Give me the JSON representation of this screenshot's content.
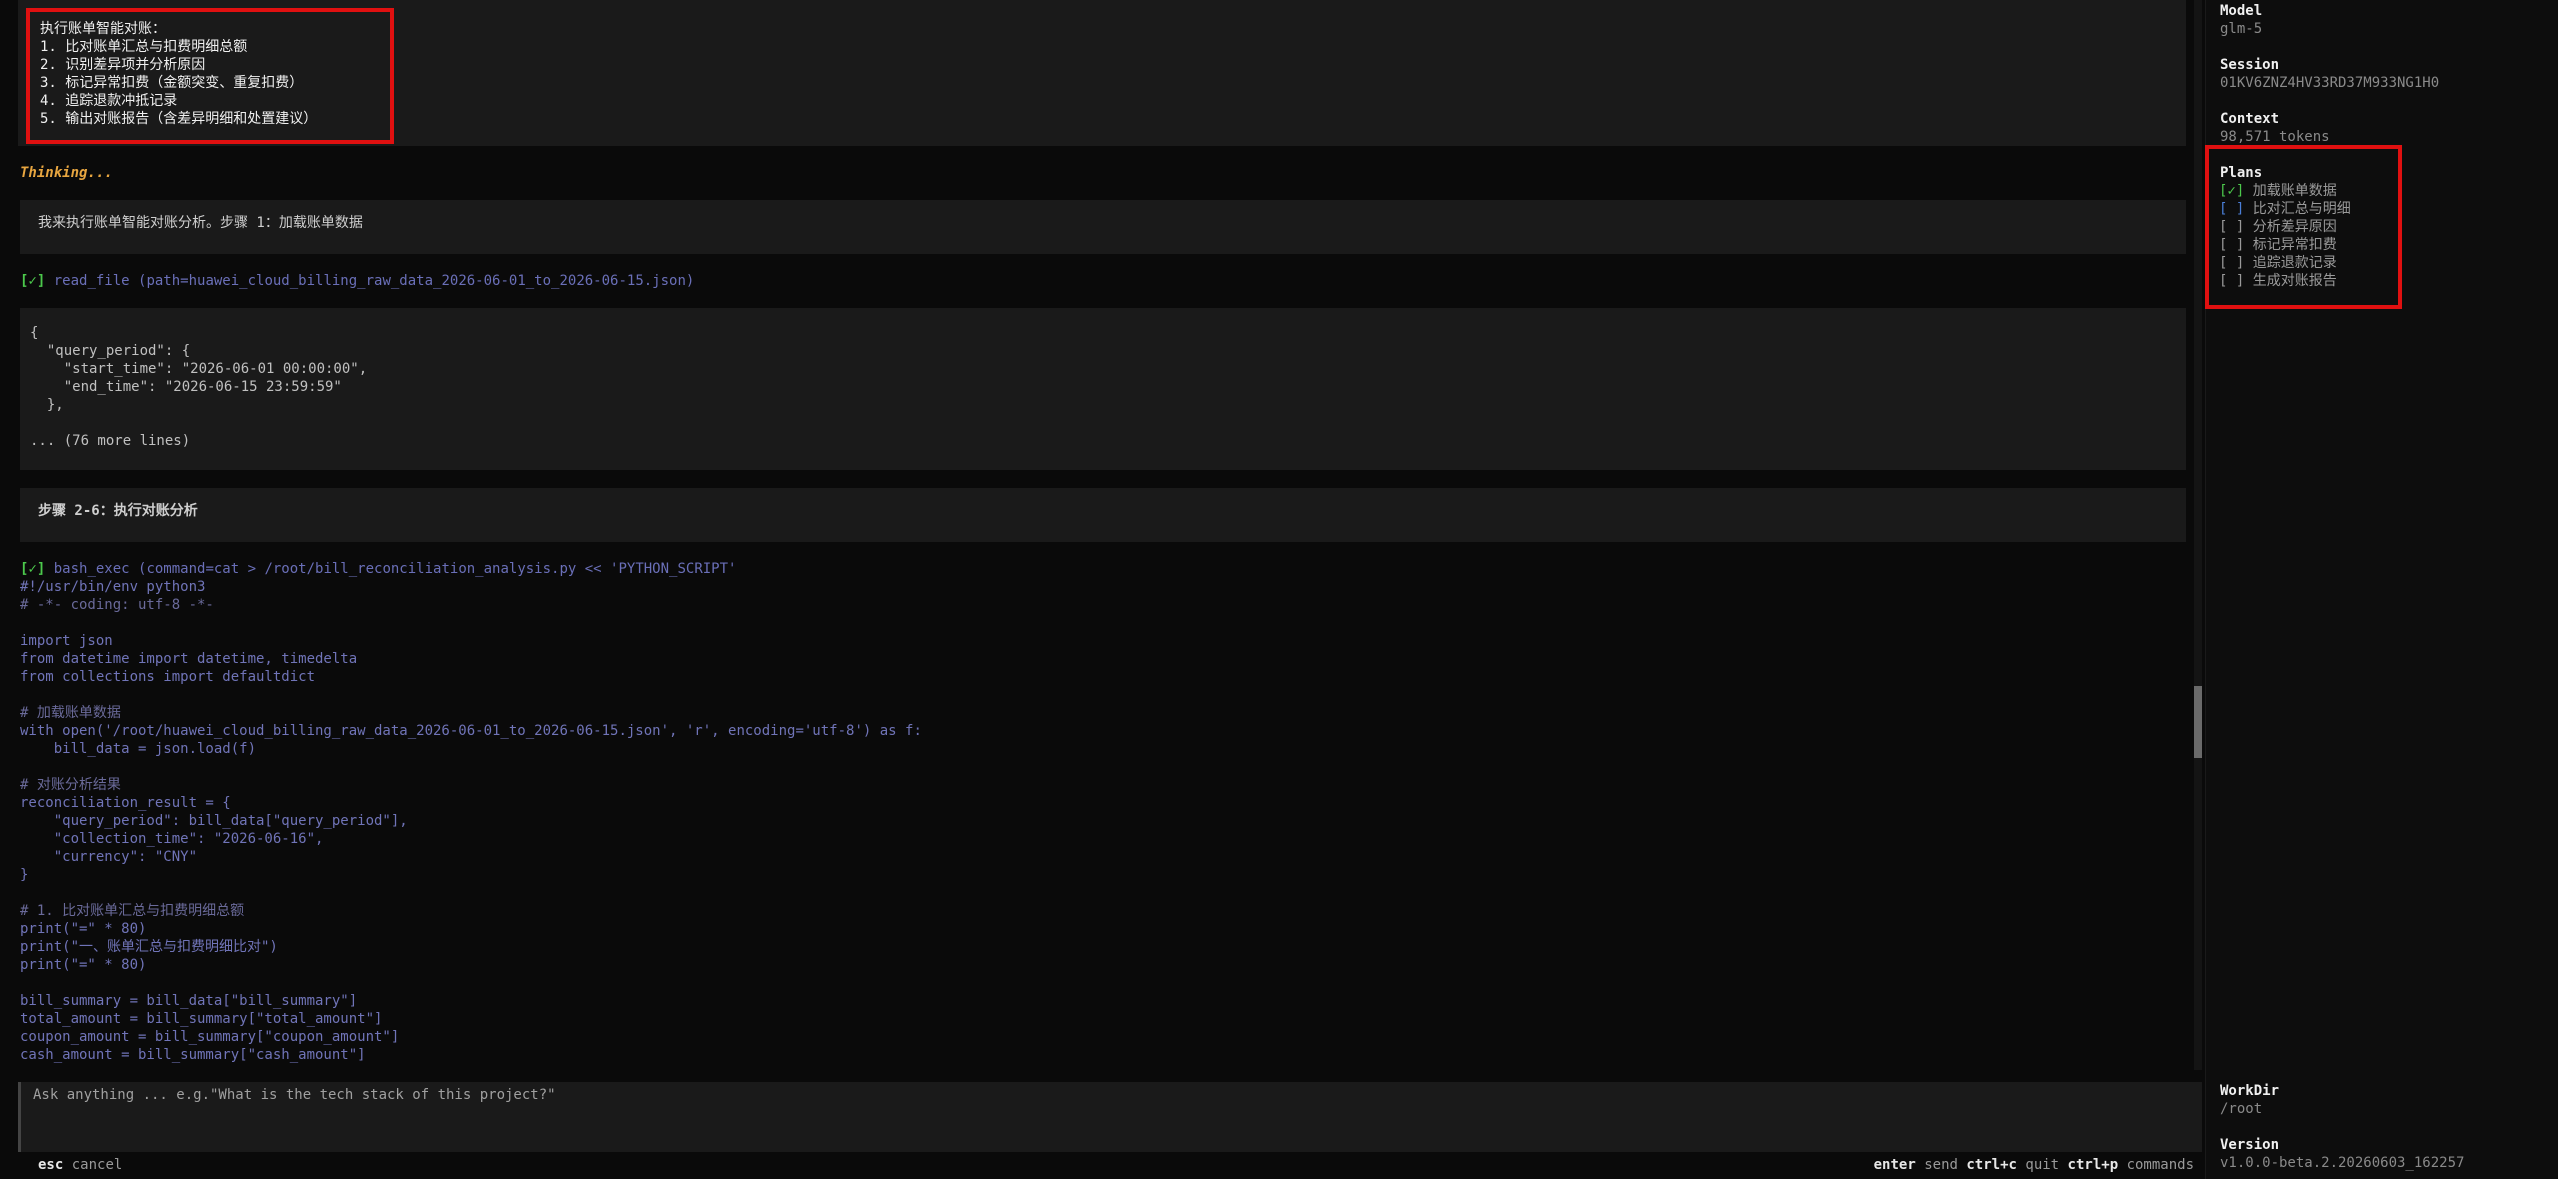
{
  "conversation": {
    "user_message_lines": [
      "执行账单智能对账：",
      "1. 比对账单汇总与扣费明细总额",
      "2. 识别差异项并分析原因",
      "3. 标记异常扣费（金额突变、重复扣费）",
      "4. 追踪退款冲抵记录",
      "5. 输出对账报告（含差异明细和处置建议）"
    ],
    "thinking_label": "Thinking...",
    "assistant_message_1": "我来执行账单智能对账分析。步骤 1：加载账单数据",
    "tool_call_1": {
      "status": "[✓]",
      "text": "read_file (path=huawei_cloud_billing_raw_data_2026-06-01_to_2026-06-15.json)"
    },
    "tool_output_1_lines": [
      "{",
      "  \"query_period\": {",
      "    \"start_time\": \"2026-06-01 00:00:00\",",
      "    \"end_time\": \"2026-06-15 23:59:59\"",
      "  },",
      "",
      "... (76 more lines)"
    ],
    "assistant_message_2": "步骤 2-6：执行对账分析",
    "tool_call_2": {
      "status": "[✓]",
      "text": "bash_exec (command=cat > /root/bill_reconciliation_analysis.py << 'PYTHON_SCRIPT'"
    },
    "code_lines": [
      "#!/usr/bin/env python3",
      "# -*- coding: utf-8 -*-",
      "",
      "import json",
      "from datetime import datetime, timedelta",
      "from collections import defaultdict",
      "",
      "# 加载账单数据",
      "with open('/root/huawei_cloud_billing_raw_data_2026-06-01_to_2026-06-15.json', 'r', encoding='utf-8') as f:",
      "    bill_data = json.load(f)",
      "",
      "# 对账分析结果",
      "reconciliation_result = {",
      "    \"query_period\": bill_data[\"query_period\"],",
      "    \"collection_time\": \"2026-06-16\",",
      "    \"currency\": \"CNY\"",
      "}",
      "",
      "# 1. 比对账单汇总与扣费明细总额",
      "print(\"=\" * 80)",
      "print(\"一、账单汇总与扣费明细比对\")",
      "print(\"=\" * 80)",
      "",
      "bill_summary = bill_data[\"bill_summary\"]",
      "total_amount = bill_summary[\"total_amount\"]",
      "coupon_amount = bill_summary[\"coupon_amount\"]",
      "cash_amount = bill_summary[\"cash_amount\"]"
    ]
  },
  "input": {
    "placeholder": "Ask anything ... e.g.\"What is the tech stack of this project?\""
  },
  "footer": {
    "esc_key": "esc",
    "esc_action": "cancel",
    "enter_key": "enter",
    "enter_action": "send",
    "quit_key": "ctrl+c",
    "quit_action": "quit",
    "cmd_key": "ctrl+p",
    "cmd_action": "commands"
  },
  "sidebar": {
    "model_label": "Model",
    "model_value": "glm-5",
    "session_label": "Session",
    "session_value": "01KV6ZNZ4HV33RD37M933NG1H0",
    "context_label": "Context",
    "context_value": "98,571 tokens",
    "plans_label": "Plans",
    "plans": [
      {
        "mark": "[✓]",
        "label": "加载账单数据",
        "state": "done"
      },
      {
        "mark": "[ ]",
        "label": "比对汇总与明细",
        "state": "current"
      },
      {
        "mark": "[ ]",
        "label": "分析差异原因",
        "state": "pending"
      },
      {
        "mark": "[ ]",
        "label": "标记异常扣费",
        "state": "pending"
      },
      {
        "mark": "[ ]",
        "label": "追踪退款记录",
        "state": "pending"
      },
      {
        "mark": "[ ]",
        "label": "生成对账报告",
        "state": "pending"
      }
    ],
    "workdir_label": "WorkDir",
    "workdir_value": "/root",
    "version_label": "Version",
    "version_value": "v1.0.0-beta.2.20260603_162257"
  }
}
